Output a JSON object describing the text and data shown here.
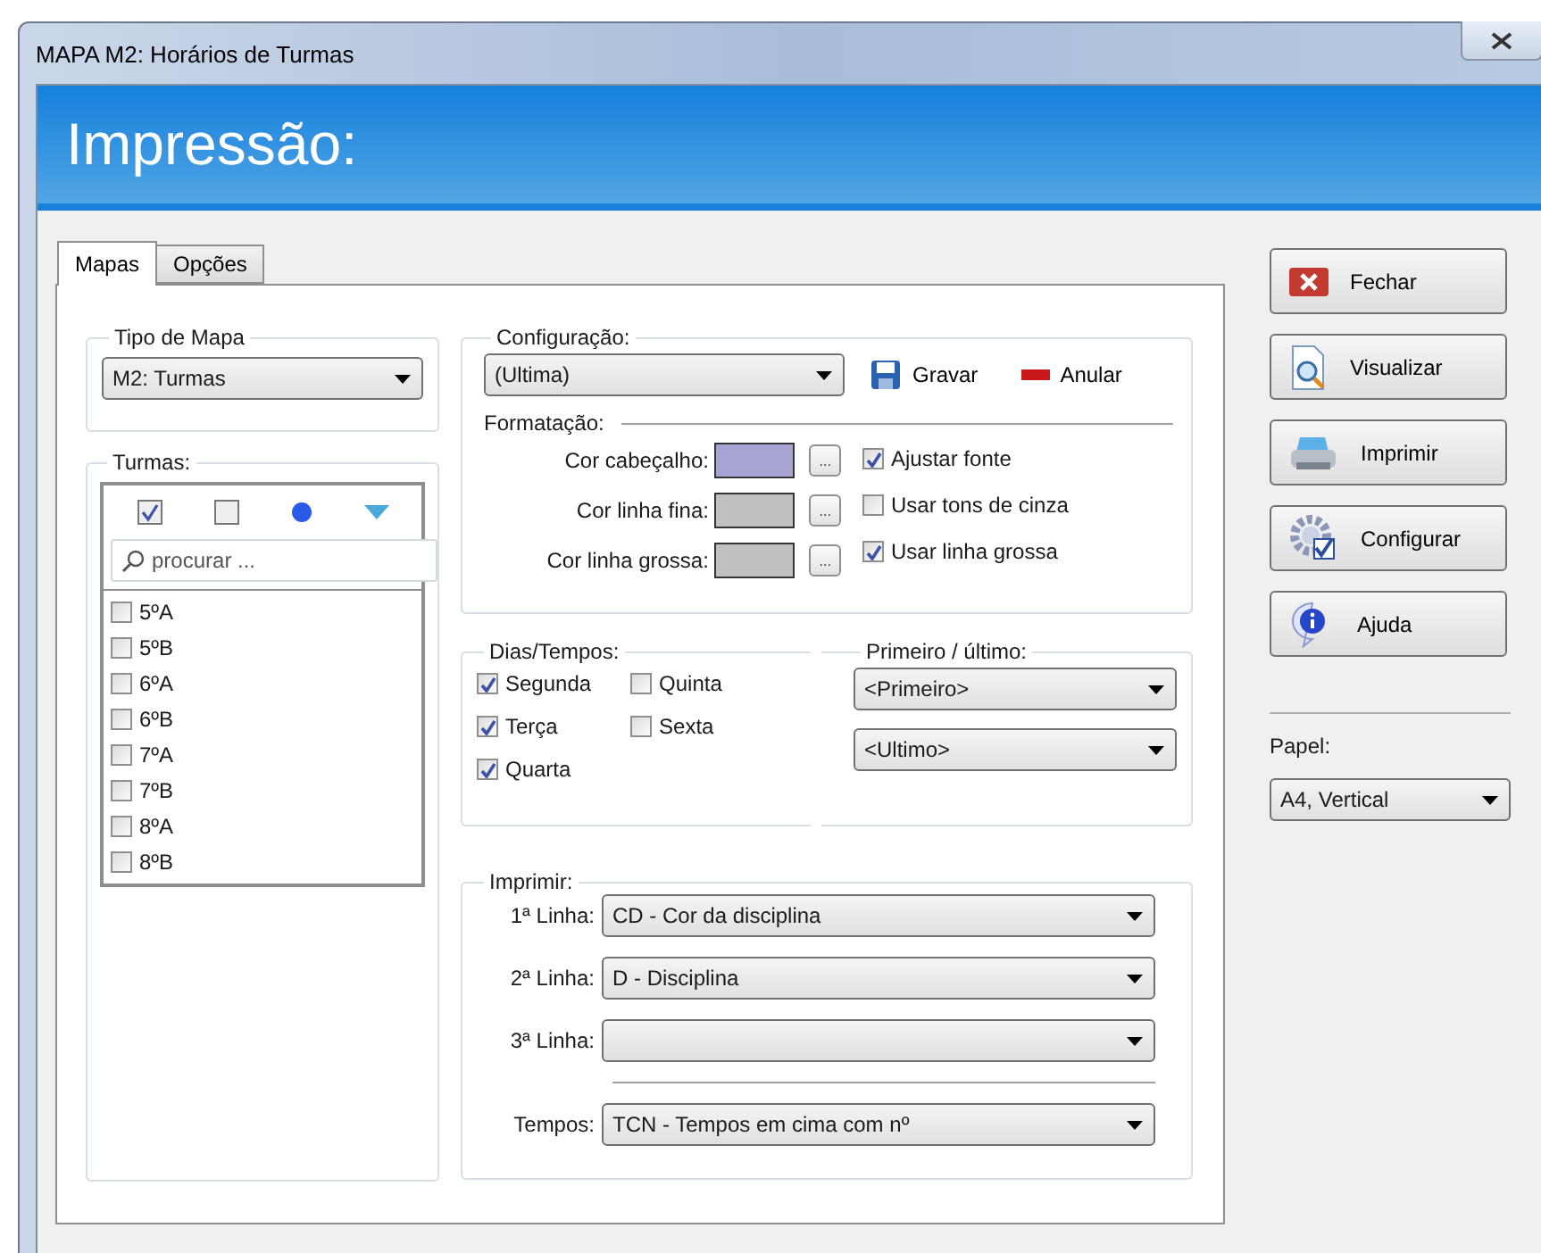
{
  "window": {
    "title": "MAPA M2: Horários de Turmas"
  },
  "banner": {
    "title": "Impressão:"
  },
  "tabs": [
    {
      "label": "Mapas",
      "selected": true
    },
    {
      "label": "Opções",
      "selected": false
    }
  ],
  "tipo_de_mapa": {
    "label": "Tipo de Mapa",
    "value": "M2: Turmas"
  },
  "turmas": {
    "label": "Turmas:",
    "search": {
      "placeholder": "procurar ..."
    },
    "items": [
      {
        "label": "5ºA",
        "checked": false
      },
      {
        "label": "5ºB",
        "checked": false
      },
      {
        "label": "6ºA",
        "checked": false
      },
      {
        "label": "6ºB",
        "checked": false
      },
      {
        "label": "7ºA",
        "checked": false
      },
      {
        "label": "7ºB",
        "checked": false
      },
      {
        "label": "8ºA",
        "checked": false
      },
      {
        "label": "8ºB",
        "checked": false
      }
    ]
  },
  "configuracao": {
    "label": "Configuração:",
    "value": "(Ultima)",
    "save": "Gravar",
    "cancel": "Anular"
  },
  "formatacao": {
    "label": "Formatação:",
    "colors": [
      {
        "label": "Cor cabeçalho:",
        "color": "#a8a4d4",
        "button": "..."
      },
      {
        "label": "Cor linha fina:",
        "color": "#c0c0c0",
        "button": "..."
      },
      {
        "label": "Cor linha grossa:",
        "color": "#c0c0c0",
        "button": "..."
      }
    ],
    "options": [
      {
        "label": "Ajustar fonte",
        "checked": true
      },
      {
        "label": "Usar tons de cinza",
        "checked": false
      },
      {
        "label": "Usar linha grossa",
        "checked": true
      }
    ]
  },
  "dias_tempos": {
    "label": "Dias/Tempos:",
    "days": [
      {
        "label": "Segunda",
        "checked": true
      },
      {
        "label": "Terça",
        "checked": true
      },
      {
        "label": "Quarta",
        "checked": true
      },
      {
        "label": "Quinta",
        "checked": false
      },
      {
        "label": "Sexta",
        "checked": false
      }
    ]
  },
  "primeiro_ultimo": {
    "label": "Primeiro / último:",
    "first": "<Primeiro>",
    "last": "<Ultimo>"
  },
  "imprimir": {
    "label": "Imprimir:",
    "lines": [
      {
        "label": "1ª Linha:",
        "value": "CD - Cor da disciplina"
      },
      {
        "label": "2ª Linha:",
        "value": "D - Disciplina"
      },
      {
        "label": "3ª Linha:"
      }
    ],
    "tempos": {
      "label": "Tempos:",
      "value": "TCN - Tempos em cima com nº"
    }
  },
  "actions": [
    {
      "label": "Fechar",
      "kind": "close"
    },
    {
      "label": "Visualizar",
      "kind": "preview"
    },
    {
      "label": "Imprimir",
      "kind": "print"
    },
    {
      "label": "Configurar",
      "kind": "configure"
    },
    {
      "label": "Ajuda",
      "kind": "help"
    }
  ],
  "papel": {
    "label": "Papel:",
    "value": "A4, Vertical"
  }
}
